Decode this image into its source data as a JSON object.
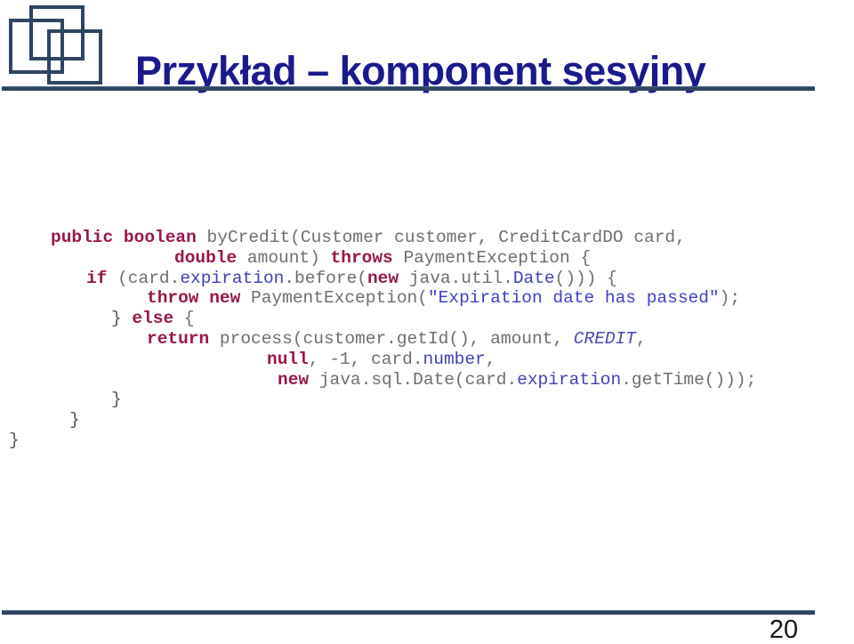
{
  "slide": {
    "title": "Przykład – komponent sesyjny",
    "page_number": "20",
    "title_color": "#1a1a8c",
    "rule_color": "#2e4561",
    "logo_color": "#2e4561",
    "logo_icon": "three-overlapping-squares-logo"
  },
  "code": {
    "language": "java",
    "colors": {
      "keyword": "#98174b",
      "identifier": "#6e6e6e",
      "field": "#4040b8",
      "string": "#4040cc",
      "constant": "#4949b5"
    },
    "lines": [
      {
        "indent": 57,
        "tokens": [
          {
            "t": "public",
            "c": "kw"
          },
          {
            "t": " ",
            "c": "plain"
          },
          {
            "t": "boolean",
            "c": "kw"
          },
          {
            "t": " byCredit(Customer customer, CreditCardDO card,",
            "c": "plain"
          }
        ]
      },
      {
        "indent": 196,
        "tokens": [
          {
            "t": "double",
            "c": "kw"
          },
          {
            "t": " amount) ",
            "c": "plain"
          },
          {
            "t": "throws",
            "c": "kw"
          },
          {
            "t": " PaymentException {",
            "c": "plain"
          }
        ]
      },
      {
        "indent": 97,
        "tokens": [
          {
            "t": "if",
            "c": "kw"
          },
          {
            "t": " (card.",
            "c": "plain"
          },
          {
            "t": "expiration",
            "c": "fld"
          },
          {
            "t": ".before(",
            "c": "plain"
          },
          {
            "t": "new",
            "c": "kw"
          },
          {
            "t": " java.util.",
            "c": "plain"
          },
          {
            "t": "Date",
            "c": "fld"
          },
          {
            "t": "())) {",
            "c": "plain"
          }
        ]
      },
      {
        "indent": 165,
        "tokens": [
          {
            "t": "throw",
            "c": "kw"
          },
          {
            "t": " ",
            "c": "plain"
          },
          {
            "t": "new",
            "c": "kw"
          },
          {
            "t": " PaymentException(",
            "c": "plain"
          },
          {
            "t": "\"Expiration date has passed\"",
            "c": "str"
          },
          {
            "t": ");",
            "c": "plain"
          }
        ]
      },
      {
        "indent": 125,
        "tokens": [
          {
            "t": "} ",
            "c": "brace"
          },
          {
            "t": "else",
            "c": "kw"
          },
          {
            "t": " {",
            "c": "plain"
          }
        ]
      },
      {
        "indent": 165,
        "tokens": [
          {
            "t": "return",
            "c": "kw"
          },
          {
            "t": " process(customer.getId(), amount, ",
            "c": "plain"
          },
          {
            "t": "CREDIT",
            "c": "cnst"
          },
          {
            "t": ",",
            "c": "plain"
          }
        ]
      },
      {
        "indent": 300,
        "tokens": [
          {
            "t": "null",
            "c": "kw"
          },
          {
            "t": ", -1, card.",
            "c": "plain"
          },
          {
            "t": "number",
            "c": "fld"
          },
          {
            "t": ",",
            "c": "plain"
          }
        ]
      },
      {
        "indent": 312,
        "tokens": [
          {
            "t": "new",
            "c": "kw"
          },
          {
            "t": " java.sql.Date(card.",
            "c": "plain"
          },
          {
            "t": "expiration",
            "c": "fld"
          },
          {
            "t": ".getTime()));",
            "c": "plain"
          }
        ]
      },
      {
        "indent": 125,
        "tokens": [
          {
            "t": "}",
            "c": "brace"
          }
        ]
      },
      {
        "indent": 78,
        "tokens": [
          {
            "t": "}",
            "c": "brace"
          }
        ]
      },
      {
        "indent": 10,
        "tokens": [
          {
            "t": "}",
            "c": "brace"
          }
        ]
      }
    ]
  }
}
